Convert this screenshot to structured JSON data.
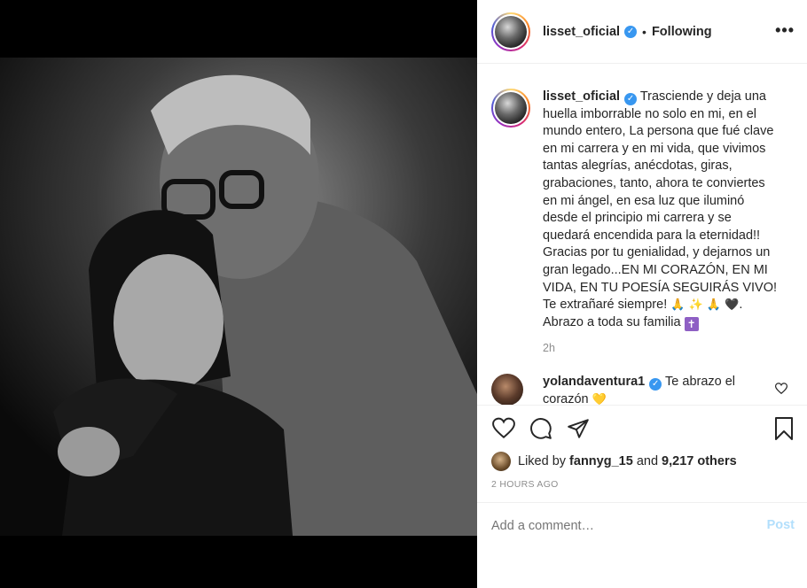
{
  "post": {
    "username": "lisset_oficial",
    "separator": "•",
    "follow_status": "Following",
    "more_icon": "•••"
  },
  "caption": {
    "username": "lisset_oficial",
    "text": "Trasciende y deja una huella imborrable no solo en mi, en el mundo entero, La persona que fué clave en mi carrera y en mi vida, que vivimos tantas alegrías, anécdotas, giras, grabaciones, tanto, ahora te conviertes en mi ángel, en esa luz que iluminó desde el principio mi carrera y se quedará encendida para la eternidad!! Gracias por tu genialidad, y dejarnos un gran legado...EN MI CORAZÓN, EN MI VIDA, EN TU POESÍA SEGUIRÁS VIVO! Te extrañaré siempre!",
    "emojis": "🙏 ✨ 🙏 🖤",
    "text_end": ". Abrazo a toda su familia",
    "cross_emoji": "✝",
    "time": "2h"
  },
  "reply": {
    "username": "yolandaventura1",
    "text": "Te abrazo el corazón",
    "emoji": "💛"
  },
  "likes": {
    "prefix": "Liked by",
    "user": "fannyg_15",
    "connector": "and",
    "count": "9,217 others"
  },
  "timestamp": "2 HOURS AGO",
  "comment_box": {
    "placeholder": "Add a comment…",
    "post_label": "Post"
  },
  "colors": {
    "verified": "#3897f0",
    "post_disabled": "#b2dffc",
    "muted": "#8e8e8e"
  }
}
